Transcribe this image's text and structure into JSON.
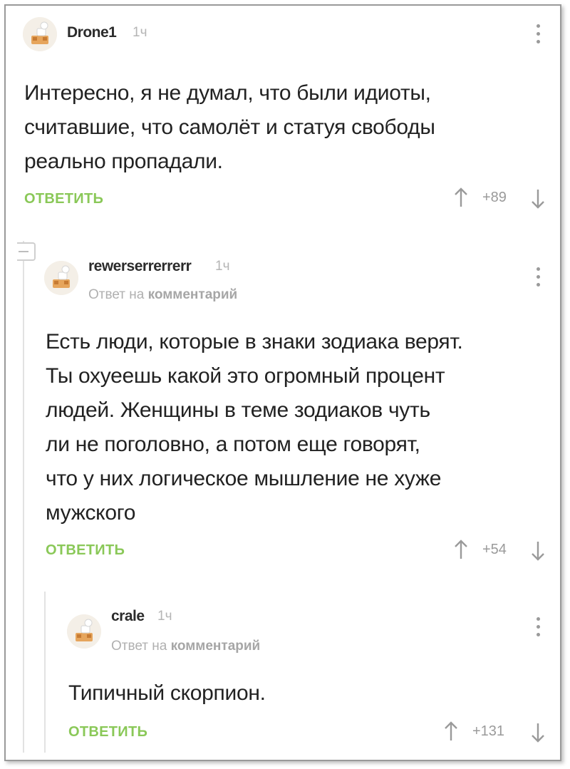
{
  "comments": [
    {
      "username": "Drone1",
      "time": "1ч",
      "text": "Интересно, я не думал, что были идиоты считавшие, что самолёт и статуя свободы реально пропадали.",
      "lines": [
        "Интересно, я не думал, что были идиоты,",
        "считавшие, что самолёт и статуя свободы",
        "реально пропадали."
      ],
      "reply_label": "ОТВЕТИТЬ",
      "score": "+89"
    },
    {
      "username": "rewerserrerrerr",
      "time": "1ч",
      "reply_to_prefix": "Ответ на",
      "reply_to_link": "комментарий",
      "lines": [
        "Есть люди, которые в знаки зодиака верят.",
        "Ты охуеешь какой это огромный процент",
        "людей. Женщины в теме зодиаков чуть",
        "ли не поголовно, а потом еще говорят,",
        "что у них логическое мышление не хуже",
        "мужского"
      ],
      "reply_label": "ОТВЕТИТЬ",
      "score": "+54"
    },
    {
      "username": "crale",
      "time": "1ч",
      "reply_to_prefix": "Ответ на",
      "reply_to_link": "комментарий",
      "lines": [
        "Типичный скорпион."
      ],
      "reply_label": "ОТВЕТИТЬ",
      "score": "+131"
    }
  ],
  "icons": {
    "vote_up": "arrow-up-icon",
    "vote_down": "arrow-down-icon",
    "more": "more-vertical-icon",
    "collapse": "collapse-thread-icon",
    "avatar": "default-avatar-icon"
  },
  "colors": {
    "reply_green": "#8ac858",
    "text": "#222222",
    "muted": "#b0b0b0"
  }
}
